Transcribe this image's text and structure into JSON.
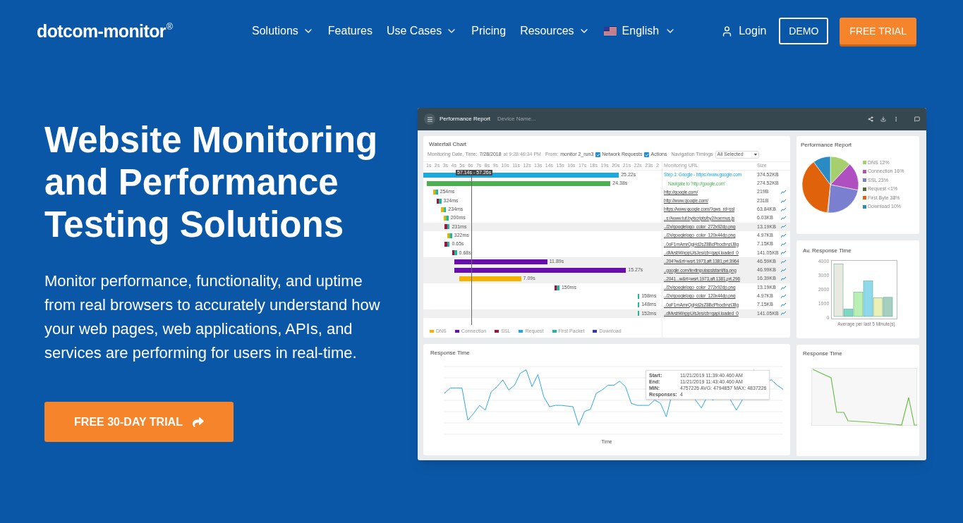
{
  "nav": {
    "logo": "dotcom-monitor",
    "logo_mark": "®",
    "items": [
      {
        "label": "Solutions",
        "dropdown": true
      },
      {
        "label": "Features",
        "dropdown": false
      },
      {
        "label": "Use Cases",
        "dropdown": true
      },
      {
        "label": "Pricing",
        "dropdown": false
      },
      {
        "label": "Resources",
        "dropdown": true
      }
    ],
    "language": "English",
    "login": "Login",
    "demo": "DEMO",
    "trial": "FREE TRIAL"
  },
  "hero": {
    "title": "Website Monitoring and Performance Testing Solutions",
    "text": "Monitor performance, functionality, and uptime from real browsers to accurately understand how your web pages, web applications, APIs, and services are performing for users in real-time.",
    "cta": "FREE 30-DAY TRIAL"
  },
  "report": {
    "title": "Performance Report",
    "subtitle": "Device Name...",
    "waterfall": {
      "title": "Waterfall Chart",
      "date_label": "Monitoring Date, Time:",
      "date": "7/28/2018",
      "time": "at 9:28:46:34 PM",
      "from_label": "From:",
      "from": "monitor 2_run3",
      "filters": [
        {
          "label": "Network Requests",
          "checked": true
        },
        {
          "label": "Actions",
          "checked": true
        }
      ],
      "timings_label": "Navigation Timings",
      "timings": "All Selected",
      "ticks": [
        "1s",
        "2s",
        "3s",
        "4s",
        "5s",
        "6s",
        "7s",
        "8s",
        "9s",
        "10s",
        "11s",
        "12s",
        "13s",
        "14s",
        "15s",
        "16s",
        "17s",
        "18s",
        "19s",
        "20s",
        "21s",
        "22s",
        "23s",
        "2"
      ],
      "marker": "57.14s - 57.26s",
      "url_header": "Monitoring URL",
      "size_header": "Size",
      "rows": [
        {
          "kind": "step",
          "duration": "25.22s",
          "url": "Step 1: Google - https://www.google.com",
          "size": "374.52KB"
        },
        {
          "kind": "navigate",
          "duration": "24.38s",
          "url": "Navigate to 'http://google.com'",
          "size": "274.52KB"
        },
        {
          "kind": "request",
          "duration": "254ms",
          "url": "http://google.com/",
          "size": "219B"
        },
        {
          "kind": "request",
          "duration": "324ms",
          "url": "http://www.google.com/",
          "size": "231B"
        },
        {
          "kind": "request",
          "duration": "234ms",
          "url": "https://www.google.com/?gws_rd=ssl",
          "size": "63.84KB"
        },
        {
          "kind": "request",
          "duration": "200ms",
          "url": "..s://www.tut.by/scripts/by2/xoemus.js",
          "size": "6.03KB"
        },
        {
          "kind": "request",
          "duration": "231ms",
          "url": "../2x/googlelogo_color_272x92dp.png",
          "size": "13.19KB"
        },
        {
          "kind": "request",
          "duration": "322ms",
          "url": "../2x/googlelogo_color_120x44dp.png",
          "size": "4.97KB"
        },
        {
          "kind": "request",
          "duration": "0.65s",
          "url": "..0oF1mAmrQqHd2sZ8BcPbocbnzlJ8g",
          "size": "7.15KB"
        },
        {
          "kind": "request",
          "duration": "0.68s",
          "url": "..dMvsbWxppU/sJes/cb=gapi.loaded_0",
          "size": "141.05KB"
        },
        {
          "kind": "request",
          "duration": "11.89s",
          "url": "..204?w&rt=wsrt.1973,aft.1381,prt.3964",
          "size": "46.59KB"
        },
        {
          "kind": "request",
          "duration": "15.27s",
          "url": "..google.com/textinputassistant/tia.png",
          "size": "46.99KB"
        },
        {
          "kind": "request",
          "duration": "7.09s",
          "url": "..2041...w&rt=wsrt.1973,aft.1381,prt.296",
          "size": "16.39KB"
        },
        {
          "kind": "request",
          "duration": "150ms",
          "url": "../2x/googlelogo_color_272x92dp.png",
          "size": "13.19KB"
        },
        {
          "kind": "request",
          "duration": "158ms",
          "url": "../2x/googlelogo_color_120x44dp.png",
          "size": "4.97KB"
        },
        {
          "kind": "request",
          "duration": "148ms",
          "url": "..0oF1mAmrQqHd2sZ8BcPbocbnzlJ8g",
          "size": "7.15KB"
        },
        {
          "kind": "request",
          "duration": "152ms",
          "url": "..dMvsbWxppU/sJes/cb=gapi.loaded_0",
          "size": "141.05KB"
        }
      ],
      "legend": [
        {
          "label": "DNS",
          "color": "#f5b300"
        },
        {
          "label": "Connection",
          "color": "#6a0dad"
        },
        {
          "label": "SSL",
          "color": "#a0143c"
        },
        {
          "label": "Request",
          "color": "#1ba9e1"
        },
        {
          "label": "First Packet",
          "color": "#1fb5a0"
        },
        {
          "label": "Download",
          "color": "#2c3fa0"
        }
      ]
    },
    "pie": {
      "title": "Performance Report",
      "chart_data": {
        "type": "pie",
        "categories": [
          "DNS 12%",
          "Connection 16%",
          "SSL 23%",
          "Request <1%",
          "First Byte 38%",
          "Download 10%"
        ],
        "series": [
          {
            "values": [
              12,
              16,
              23,
              0.5,
              38,
              10
            ]
          }
        ],
        "colors": [
          "#a6cf6e",
          "#b04fc0",
          "#7b7fd0",
          "#556b3a",
          "#e0620a",
          "#2a8bc4"
        ]
      }
    },
    "bars": {
      "title": "Av. Response Time",
      "xlabel": "Average per last 5 Minute(s)",
      "y_ticks": [
        "4000",
        "3000",
        "2000",
        "1000",
        "0"
      ]
    },
    "line": {
      "title": "Response Time",
      "xlabel": "Time",
      "tooltip": [
        {
          "label": "Start:",
          "value": "11/21/2019 11:39:40.460 AM"
        },
        {
          "label": "End:",
          "value": "11/21/2019 11:43:40.460 AM"
        },
        {
          "label": "MIN:",
          "value": "4757226 AVG: 4794857 MAX: 4837226"
        },
        {
          "label": "Responses:",
          "value": "4"
        }
      ]
    },
    "small_line": {
      "title": "Response Time"
    }
  }
}
